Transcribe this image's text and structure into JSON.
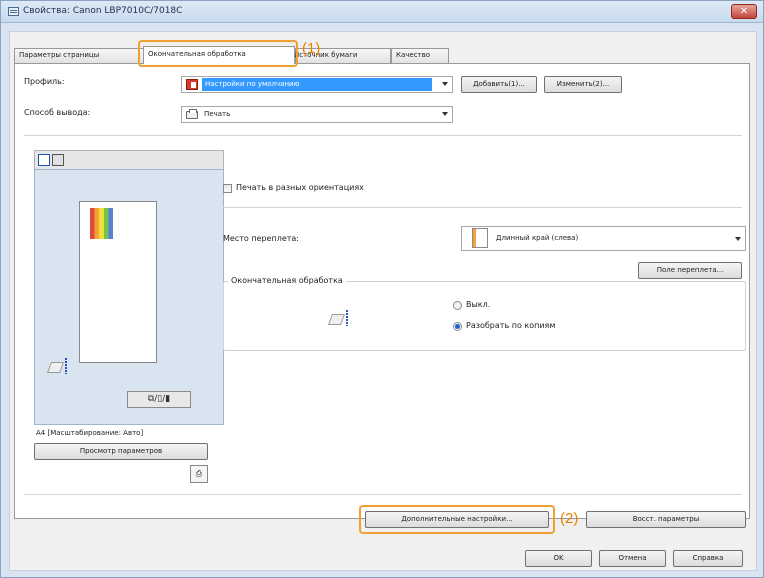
{
  "window": {
    "title": "Свойства: Canon LBP7010C/7018C",
    "close_glyph": "✕"
  },
  "tabs": [
    {
      "label": "Параметры страницы"
    },
    {
      "label": "Окончательная обработка"
    },
    {
      "label": "Источник бумаги"
    },
    {
      "label": "Качество"
    }
  ],
  "callouts": {
    "one": "(1)",
    "two": "(2)"
  },
  "profile": {
    "label": "Профиль:",
    "value": "Настройки по умолчанию",
    "add_button": "Добавить(1)...",
    "edit_button": "Изменить(2)..."
  },
  "output": {
    "label": "Способ вывода:",
    "value": "Печать"
  },
  "preview": {
    "status": "А4 [Масштабирование: Авто]",
    "finish_tool_glyphs": "⧉/▯/▮"
  },
  "view_settings_button": "Просмотр параметров",
  "mixed_orientation": {
    "label": "Печать в разных ориентациях",
    "checked": false
  },
  "binding": {
    "label": "Место переплета:",
    "value": "Длинный край (слева)",
    "gutter_button": "Поле переплета..."
  },
  "finishing": {
    "group_title": "Окончательная обработка",
    "options": [
      {
        "label": "Выкл.",
        "selected": false
      },
      {
        "label": "Разобрать по копиям",
        "selected": true
      }
    ]
  },
  "advanced_button": "Дополнительные настройки...",
  "restore_button": "Восст. параметры",
  "dialog_buttons": {
    "ok": "OK",
    "cancel": "Отмена",
    "help": "Справка"
  }
}
